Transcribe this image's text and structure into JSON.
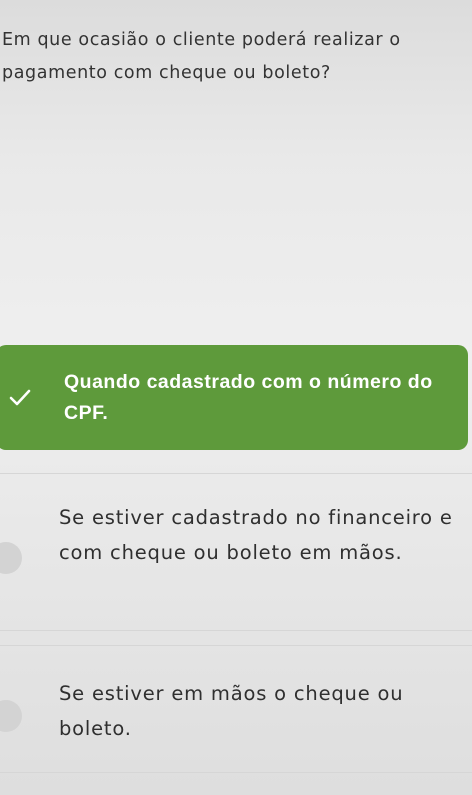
{
  "question": {
    "text": "Em que ocasião o cliente poderá realizar o pagamento com cheque ou boleto?"
  },
  "options": [
    {
      "text": "Quando cadastrado com o número do CPF.",
      "state": "selected-correct",
      "icon": "check-icon",
      "accent_color": "#5e9a3b"
    },
    {
      "text": "Se estiver cadastrado no financeiro e com cheque ou boleto em mãos.",
      "state": "unselected"
    },
    {
      "text": "Se estiver em mãos o cheque ou boleto.",
      "state": "unselected"
    }
  ]
}
